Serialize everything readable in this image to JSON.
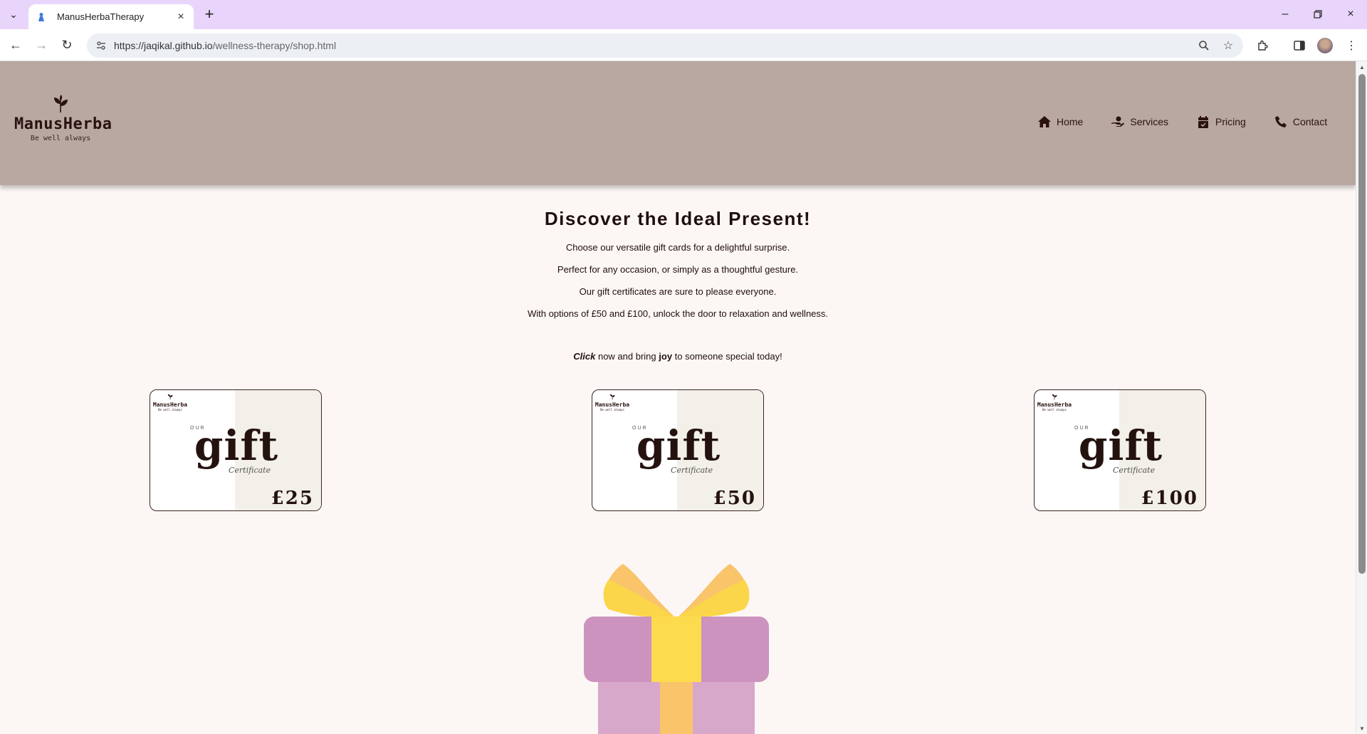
{
  "browser": {
    "tab_title": "ManusHerbaTherapy",
    "url_host": "https://jaqikal.github.io",
    "url_path": "/wellness-therapy/shop.html",
    "icons": [
      "tab-search-icon",
      "favicon-icon",
      "close-icon",
      "plus-icon",
      "minimize-icon",
      "restore-icon",
      "close-window-icon",
      "back-icon",
      "forward-icon",
      "reload-icon",
      "site-info-icon",
      "zoom-icon",
      "star-icon",
      "extensions-icon",
      "side-panel-icon",
      "profile-avatar",
      "kebab-menu-icon"
    ],
    "theme_color": "#e9d5fb"
  },
  "header": {
    "logo_name": "ManusHerba",
    "logo_tagline": "Be well always",
    "bg_color": "#b8a8a1",
    "nav": [
      {
        "label": "Home",
        "icon": "home-icon"
      },
      {
        "label": "Services",
        "icon": "hand-heart-icon"
      },
      {
        "label": "Pricing",
        "icon": "calendar-icon"
      },
      {
        "label": "Contact",
        "icon": "phone-icon"
      }
    ]
  },
  "main": {
    "heading": "Discover the Ideal Present!",
    "paragraphs": [
      "Choose our versatile gift cards for a delightful surprise.",
      "Perfect for any occasion, or simply as a thoughtful gesture.",
      "Our gift certificates are sure to please everyone.",
      "With options of £50 and £100, unlock the door to relaxation and wellness."
    ],
    "cta": {
      "click": "Click",
      "mid": " now and bring ",
      "joy": "joy",
      "end": " to someone special today!"
    }
  },
  "cards": [
    {
      "brand": "ManusHerba",
      "tagline": "Be well always",
      "our": "OUR",
      "gift": "gift",
      "cert": "Certificate",
      "price": "£25"
    },
    {
      "brand": "ManusHerba",
      "tagline": "Be well always",
      "our": "OUR",
      "gift": "gift",
      "cert": "Certificate",
      "price": "£50"
    },
    {
      "brand": "ManusHerba",
      "tagline": "Be well always",
      "our": "OUR",
      "gift": "gift",
      "cert": "Certificate",
      "price": "£100"
    }
  ],
  "colors": {
    "page_bg": "#fcf7f5",
    "text_dark": "#1f0e0c",
    "gift_box_pink": "#cc93be",
    "gift_ribbon_yellow": "#fddb4f"
  }
}
